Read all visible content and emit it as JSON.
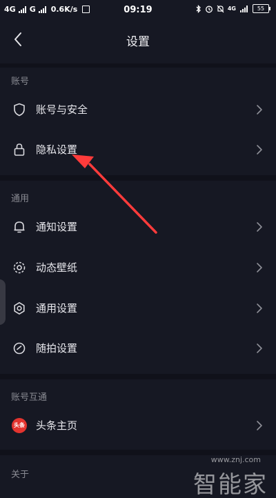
{
  "status_bar": {
    "network1": "4G",
    "network2": "G",
    "net_speed": "0.6K/s",
    "time": "09:19",
    "net_right": "4G",
    "battery": "55"
  },
  "header": {
    "title": "设置",
    "back_icon": "chevron-left-icon"
  },
  "sections": [
    {
      "label": "账号",
      "items": [
        {
          "label": "账号与安全",
          "icon": "shield-icon"
        },
        {
          "label": "隐私设置",
          "icon": "lock-icon"
        }
      ]
    },
    {
      "label": "通用",
      "items": [
        {
          "label": "通知设置",
          "icon": "bell-icon"
        },
        {
          "label": "动态壁纸",
          "icon": "wallpaper-icon"
        },
        {
          "label": "通用设置",
          "icon": "gear-icon"
        },
        {
          "label": "随拍设置",
          "icon": "camera-timer-icon"
        }
      ]
    },
    {
      "label": "账号互通",
      "items": [
        {
          "label": "头条主页",
          "icon": "toutiao-logo-icon",
          "logo_text": "头条"
        }
      ]
    },
    {
      "label": "关于",
      "items": []
    }
  ],
  "watermark": {
    "domain": "www.znj.com",
    "brand": "智能家"
  },
  "colors": {
    "background": "#161823",
    "accent_arrow": "#ff3b3b",
    "toutiao_red": "#e3342f"
  }
}
